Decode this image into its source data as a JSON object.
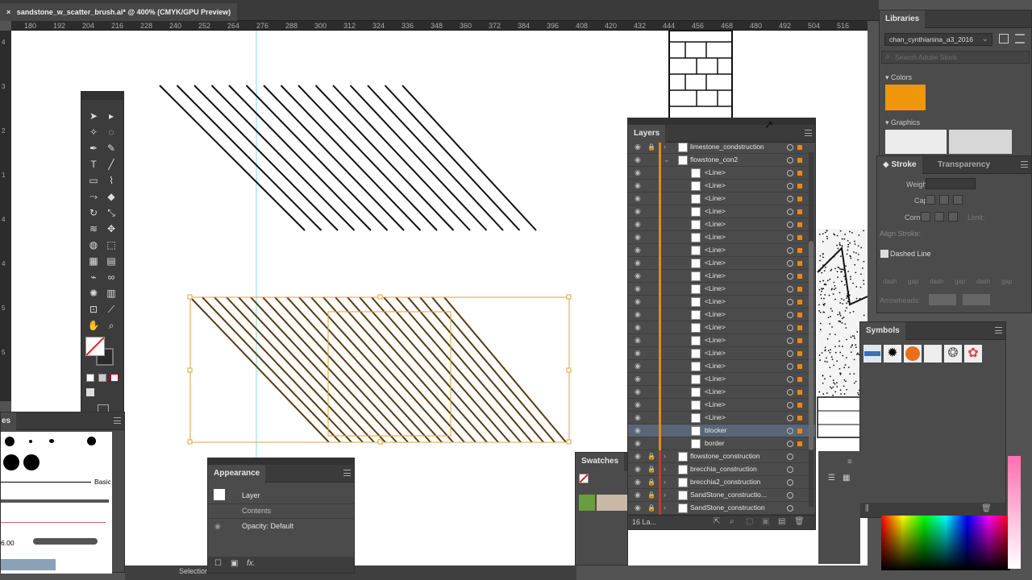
{
  "document": {
    "tab_title": "sandstone_w_scatter_brush.ai* @ 400% (CMYK/GPU Preview)",
    "close": "×"
  },
  "ruler": {
    "marks": [
      "180",
      "192",
      "204",
      "216",
      "228",
      "240",
      "252",
      "264",
      "276",
      "288",
      "300",
      "312",
      "324",
      "336",
      "348",
      "360",
      "372",
      "384",
      "396",
      "408",
      "420",
      "432",
      "444",
      "456",
      "468",
      "480",
      "492",
      "504",
      "516"
    ]
  },
  "vertical_ruler": {
    "marks": [
      "4",
      "3",
      "2",
      "1",
      "4",
      "4",
      "5",
      "5"
    ]
  },
  "status": {
    "tool": "Selection"
  },
  "layers": {
    "title": "Layers",
    "rows": [
      {
        "name": "limestone_condstruction",
        "kind": "layer",
        "lock": true,
        "color": "orange",
        "expanded": false,
        "selected": false
      },
      {
        "name": "flowstone_con2",
        "kind": "group",
        "lock": false,
        "color": "orange",
        "expanded": true,
        "selected": false
      },
      {
        "name": "<Line>",
        "kind": "line"
      },
      {
        "name": "<Line>",
        "kind": "line"
      },
      {
        "name": "<Line>",
        "kind": "line"
      },
      {
        "name": "<Line>",
        "kind": "line"
      },
      {
        "name": "<Line>",
        "kind": "line"
      },
      {
        "name": "<Line>",
        "kind": "line"
      },
      {
        "name": "<Line>",
        "kind": "line"
      },
      {
        "name": "<Line>",
        "kind": "line"
      },
      {
        "name": "<Line>",
        "kind": "line"
      },
      {
        "name": "<Line>",
        "kind": "line"
      },
      {
        "name": "<Line>",
        "kind": "line"
      },
      {
        "name": "<Line>",
        "kind": "line"
      },
      {
        "name": "<Line>",
        "kind": "line"
      },
      {
        "name": "<Line>",
        "kind": "line"
      },
      {
        "name": "<Line>",
        "kind": "line"
      },
      {
        "name": "<Line>",
        "kind": "line"
      },
      {
        "name": "<Line>",
        "kind": "line"
      },
      {
        "name": "<Line>",
        "kind": "line"
      },
      {
        "name": "<Line>",
        "kind": "line"
      },
      {
        "name": "<Line>",
        "kind": "line"
      },
      {
        "name": "blocker",
        "kind": "line",
        "selected": true
      },
      {
        "name": "border",
        "kind": "line"
      },
      {
        "name": "flowstone_construction",
        "kind": "layer",
        "lock": true,
        "color": "red"
      },
      {
        "name": "brecchia_construction",
        "kind": "layer",
        "lock": true,
        "color": "red"
      },
      {
        "name": "brecchia2_construction",
        "kind": "layer",
        "lock": true,
        "color": "red"
      },
      {
        "name": "SandStone_constructio...",
        "kind": "layer",
        "lock": true,
        "color": "red"
      },
      {
        "name": "SandStone_construction",
        "kind": "layer",
        "lock": true,
        "color": "red"
      }
    ],
    "footer": "16 La..."
  },
  "appearance": {
    "title": "Appearance",
    "item": "Layer",
    "contents": "Contents",
    "opacity_label": "Opacity:",
    "opacity_value": "Default",
    "fx": "fx."
  },
  "libraries": {
    "title": "Libraries",
    "library_name": "chan_cynthianina_a3_2016",
    "search_placeholder": "Search Adobe Stock",
    "colors_label": "Colors",
    "graphics_label": "Graphics",
    "swatch_color": "#f0960a"
  },
  "stroke": {
    "tab": "Stroke",
    "tab2": "Transparency",
    "weight_label": "Weight:",
    "cap_label": "Cap:",
    "corner_label": "Corner:",
    "limit_label": "Limit:",
    "align_label": "Align Stroke:",
    "dashed_label": "Dashed Line",
    "dash_labels": [
      "dash",
      "gap",
      "dash",
      "gap",
      "dash",
      "gap"
    ],
    "arrowheads_label": "Arrowheads:"
  },
  "symbols": {
    "title": "Symbols"
  },
  "swatches": {
    "title": "Swatches"
  },
  "brushes": {
    "title": "es",
    "basic_label": "Basic",
    "size_label": "6.00"
  }
}
